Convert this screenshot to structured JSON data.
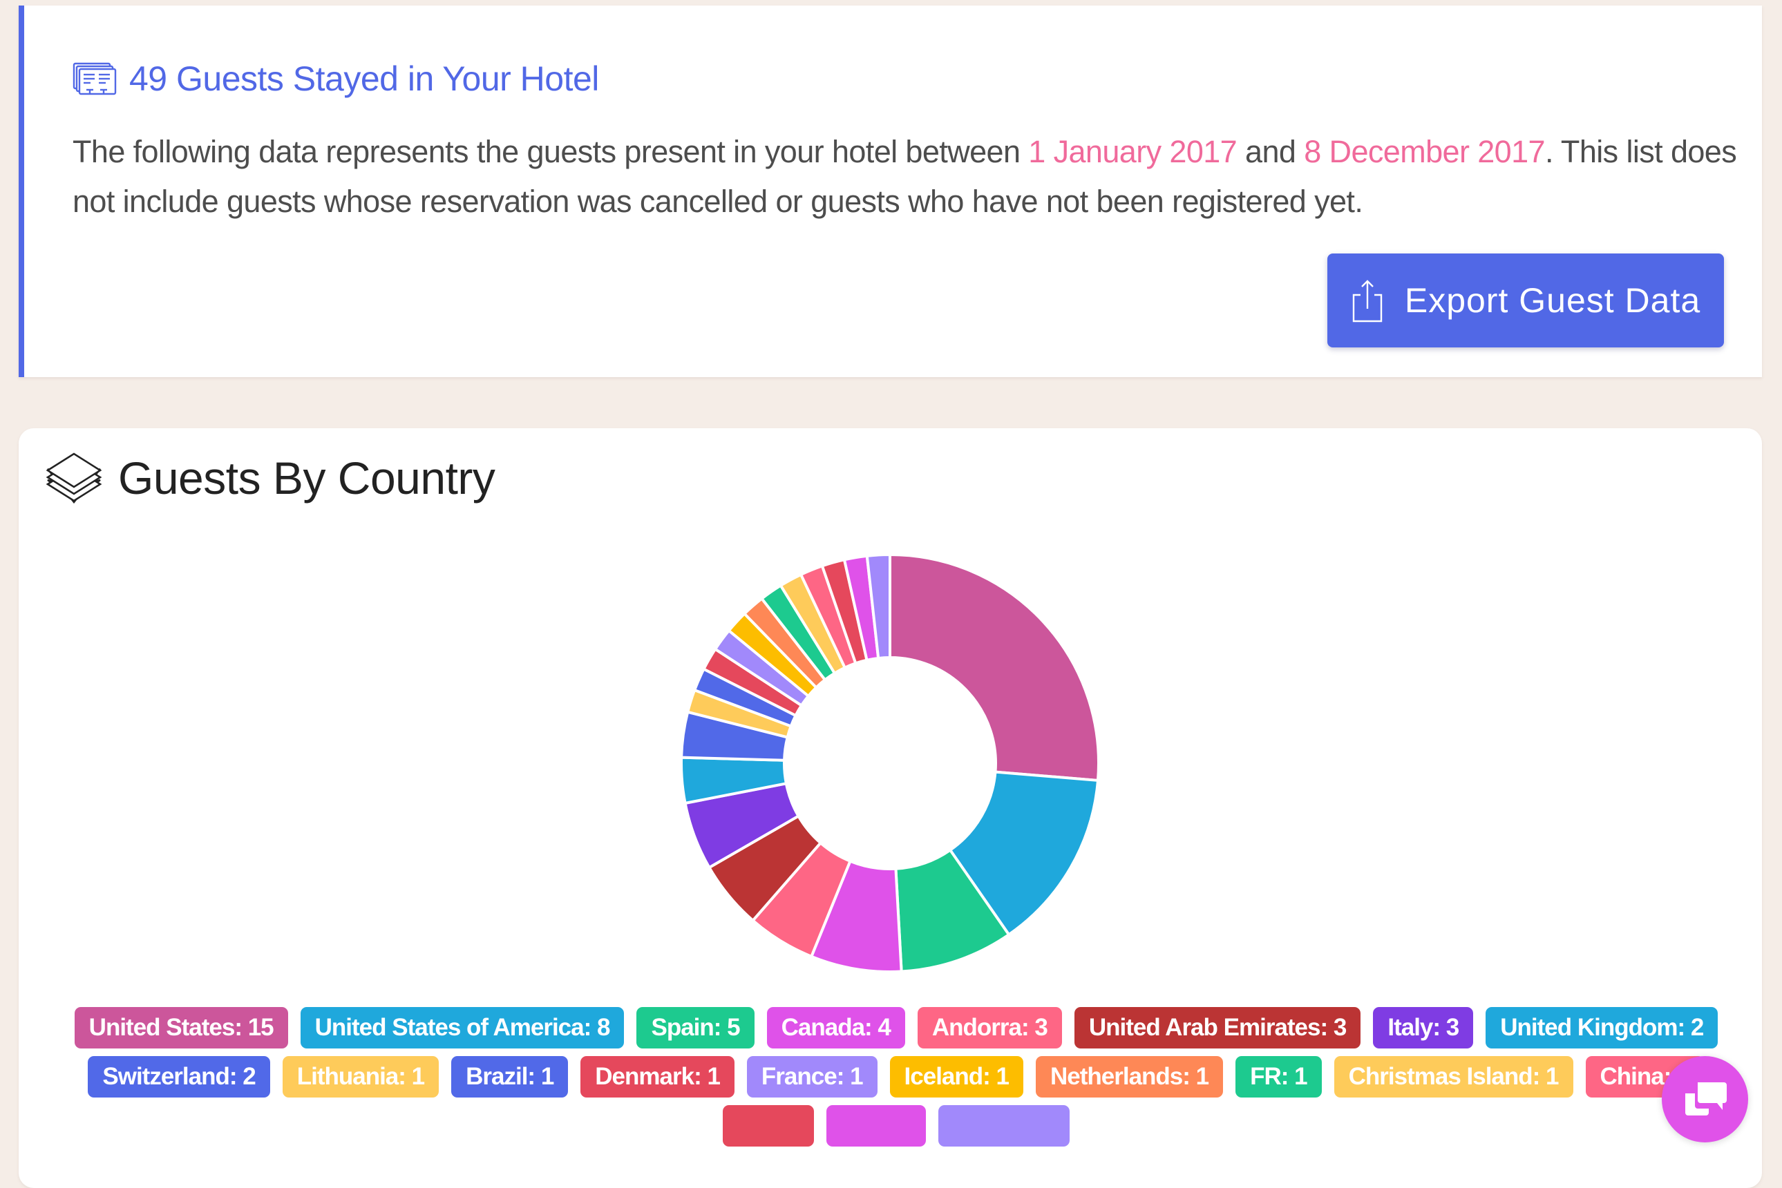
{
  "summary_card": {
    "icon": "guest-list-icon",
    "title": "49 Guests Stayed in Your Hotel",
    "body_before": "The following data represents the guests present in your hotel between ",
    "start_date": "1 January 2017",
    "body_middle": " and ",
    "end_date": "8 December 2017",
    "body_after": ". This list does not include guests whose reservation was cancelled or guests who have not been registered yet.",
    "export_button": {
      "label": "Export Guest Data",
      "icon": "share-export-icon"
    },
    "colors": {
      "accent": "#5168e6",
      "highlight": "#f06a9b",
      "text": "#4d4d4d"
    }
  },
  "country_card": {
    "icon": "layers-icon",
    "title": "Guests By Country"
  },
  "chat_button": {
    "icon": "chat-bubbles-icon",
    "color": "#e052e9"
  },
  "chart_data": {
    "type": "pie",
    "variant": "doughnut",
    "title": "Guests By Country",
    "legend_position": "bottom",
    "start_angle_deg": 0,
    "direction": "clockwise",
    "categories": [
      "United States",
      "United States of America",
      "Spain",
      "Canada",
      "Andorra",
      "United Arab Emirates",
      "Italy",
      "United Kingdom",
      "Switzerland",
      "Lithuania",
      "Brazil",
      "Denmark",
      "France",
      "Iceland",
      "Netherlands",
      "FR",
      "Christmas Island",
      "China",
      "",
      "",
      ""
    ],
    "values": [
      15,
      8,
      5,
      4,
      3,
      3,
      3,
      2,
      2,
      1,
      1,
      1,
      1,
      1,
      1,
      1,
      1,
      1,
      1,
      1,
      1
    ],
    "colors": [
      "#cc569b",
      "#1fa8dc",
      "#1dca8f",
      "#df52e9",
      "#fe6685",
      "#bb3434",
      "#7f3ce3",
      "#1fa8dc",
      "#5169e8",
      "#fecb5a",
      "#5169e8",
      "#e5485c",
      "#a189fb",
      "#fdbd00",
      "#fe8856",
      "#1dca8f",
      "#fecb5a",
      "#fe6685",
      "#e5485c",
      "#df52e9",
      "#a189fb"
    ],
    "legend_labels": [
      "United States: 15",
      "United States of America: 8",
      "Spain: 5",
      "Canada: 4",
      "Andorra: 3",
      "United Arab Emirates: 3",
      "Italy: 3",
      "United Kingdom: 2",
      "Switzerland: 2",
      "Lithuania: 1",
      "Brazil: 1",
      "Denmark: 1",
      "France: 1",
      "Iceland: 1",
      "Netherlands: 1",
      "FR: 1",
      "Christmas Island: 1",
      "China: 1",
      "",
      "",
      ""
    ]
  }
}
